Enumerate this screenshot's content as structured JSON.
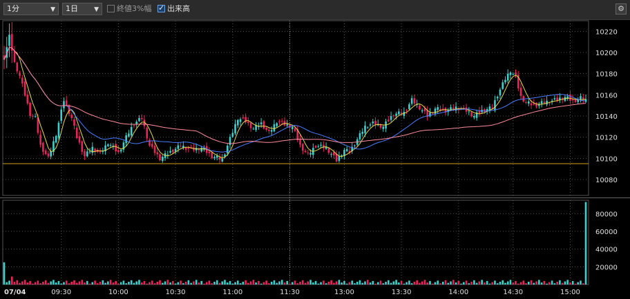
{
  "toolbar": {
    "interval": "1分",
    "period": "1日",
    "option_range_label": "終値3%幅",
    "option_range_checked": false,
    "option_volume_label": "出来高",
    "option_volume_checked": true,
    "settings_icon": "gear-icon"
  },
  "colors": {
    "background": "#000000",
    "up": "#3fd0cc",
    "down": "#e8265a",
    "ma_short": "#e6d94a",
    "ma_mid": "#4a7dff",
    "ma_long": "#ff8c9a",
    "ref_line": "#d4a017",
    "grid": "#555555",
    "axis_text": "#e0e0e0"
  },
  "chart_data": [
    {
      "type": "candlestick",
      "name": "price",
      "ylim": [
        10065,
        10230
      ],
      "yticks": [
        10080,
        10100,
        10120,
        10140,
        10160,
        10180,
        10200,
        10220
      ],
      "reference_line": 10095,
      "date_label": "07/04",
      "time_labels": [
        "09:30",
        "10:00",
        "10:30",
        "11:00",
        "11:30",
        "13:00",
        "13:30",
        "14:00",
        "14:30",
        "15:00"
      ],
      "moving_averages": [
        "short",
        "mid",
        "long"
      ],
      "close_path": [
        [
          0,
          10195
        ],
        [
          2,
          10215
        ],
        [
          4,
          10190
        ],
        [
          6,
          10178
        ],
        [
          8,
          10160
        ],
        [
          10,
          10142
        ],
        [
          12,
          10138
        ],
        [
          14,
          10112
        ],
        [
          17,
          10100
        ],
        [
          20,
          10123
        ],
        [
          23,
          10155
        ],
        [
          26,
          10138
        ],
        [
          28,
          10120
        ],
        [
          31,
          10102
        ],
        [
          34,
          10110
        ],
        [
          37,
          10104
        ],
        [
          40,
          10115
        ],
        [
          44,
          10105
        ],
        [
          47,
          10120
        ],
        [
          50,
          10133
        ],
        [
          53,
          10138
        ],
        [
          56,
          10112
        ],
        [
          60,
          10100
        ],
        [
          64,
          10106
        ],
        [
          68,
          10112
        ],
        [
          72,
          10108
        ],
        [
          76,
          10110
        ],
        [
          80,
          10102
        ],
        [
          84,
          10099
        ],
        [
          88,
          10125
        ],
        [
          90,
          10138
        ],
        [
          93,
          10135
        ],
        [
          96,
          10128
        ],
        [
          99,
          10133
        ],
        [
          102,
          10124
        ],
        [
          105,
          10135
        ],
        [
          108,
          10132
        ],
        [
          111,
          10130
        ],
        [
          114,
          10112
        ],
        [
          117,
          10103
        ],
        [
          120,
          10112
        ],
        [
          124,
          10110
        ],
        [
          128,
          10098
        ],
        [
          131,
          10108
        ],
        [
          133,
          10106
        ],
        [
          136,
          10118
        ],
        [
          139,
          10130
        ],
        [
          142,
          10133
        ],
        [
          146,
          10130
        ],
        [
          150,
          10142
        ],
        [
          154,
          10143
        ],
        [
          157,
          10155
        ],
        [
          160,
          10148
        ],
        [
          163,
          10140
        ],
        [
          166,
          10147
        ],
        [
          170,
          10145
        ],
        [
          174,
          10148
        ],
        [
          178,
          10145
        ],
        [
          181,
          10140
        ],
        [
          184,
          10145
        ],
        [
          188,
          10148
        ],
        [
          190,
          10160
        ],
        [
          193,
          10175
        ],
        [
          195,
          10183
        ],
        [
          197,
          10176
        ],
        [
          199,
          10158
        ],
        [
          201,
          10153
        ],
        [
          204,
          10150
        ],
        [
          208,
          10153
        ],
        [
          212,
          10155
        ],
        [
          216,
          10158
        ],
        [
          219,
          10154
        ],
        [
          222,
          10157
        ],
        [
          224,
          10155
        ]
      ]
    },
    {
      "type": "bar",
      "name": "volume",
      "ylim": [
        0,
        95000
      ],
      "yticks": [
        20000,
        40000,
        60000,
        80000
      ],
      "notable_values": [
        {
          "index": 0,
          "value": 25000
        },
        {
          "index": 3,
          "value": 9000
        },
        {
          "index": 224,
          "value": 93000
        }
      ],
      "typical_range": [
        1000,
        8000
      ]
    }
  ]
}
